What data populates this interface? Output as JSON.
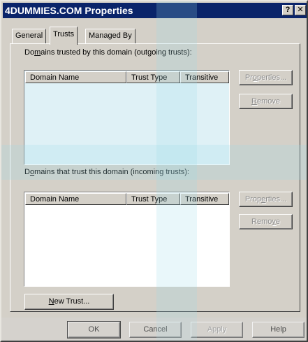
{
  "window": {
    "title": "4DUMMIES.COM Properties",
    "help_button": "?",
    "close_button": "✕"
  },
  "tabs": [
    {
      "label": "General",
      "active": false
    },
    {
      "label": "Trusts",
      "active": true
    },
    {
      "label": "Managed By",
      "active": false
    }
  ],
  "outgoing": {
    "label_pre": "Do",
    "label_key": "m",
    "label_post": "ains trusted by this domain (outgoing trusts):",
    "columns": [
      "Domain Name",
      "Trust Type",
      "Transitive"
    ],
    "rows": [],
    "properties_pre": "Pr",
    "properties_key": "o",
    "properties_post": "perties...",
    "remove_pre": "",
    "remove_key": "R",
    "remove_post": "emove"
  },
  "incoming": {
    "label_pre": "D",
    "label_key": "o",
    "label_post": "mains that trust this domain (incoming trusts):",
    "columns": [
      "Domain Name",
      "Trust Type",
      "Transitive"
    ],
    "rows": [],
    "properties_pre": "Prop",
    "properties_key": "e",
    "properties_post": "rties...",
    "remove_pre": "Remo",
    "remove_key": "v",
    "remove_post": "e"
  },
  "new_trust": {
    "pre": "",
    "key": "N",
    "post": "ew Trust..."
  },
  "footer": {
    "ok": "OK",
    "cancel": "Cancel",
    "apply": "Apply",
    "help": "Help"
  },
  "colors": {
    "titlebar": "#0a246a",
    "face": "#d4d0c8",
    "list_tint": "#dff1f6"
  }
}
